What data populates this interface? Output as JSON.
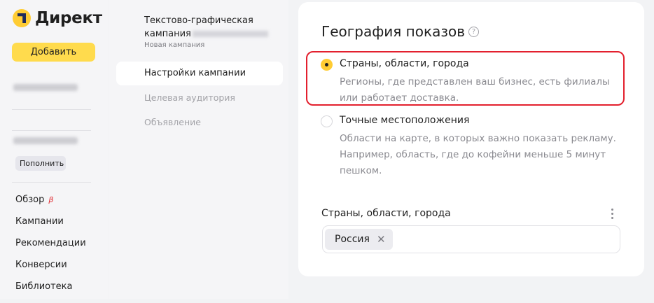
{
  "sidebar": {
    "logo_text": "Директ",
    "add_button": "Добавить",
    "topup_button": "Пополнить",
    "nav": [
      {
        "label": "Обзор",
        "badge": "β"
      },
      {
        "label": "Кампании"
      },
      {
        "label": "Рекомендации"
      },
      {
        "label": "Конверсии"
      },
      {
        "label": "Библиотека"
      }
    ]
  },
  "steps_panel": {
    "campaign_title_line1": "Текстово-графическая",
    "campaign_title_line2": "кампания",
    "campaign_subtitle": "Новая кампания",
    "steps": [
      {
        "label": "Настройки кампании",
        "active": true
      },
      {
        "label": "Целевая аудитория",
        "active": false
      },
      {
        "label": "Объявление",
        "active": false
      }
    ]
  },
  "main": {
    "title": "География показов",
    "help_icon": "?",
    "options": [
      {
        "label": "Страны, области, города",
        "description": "Регионы, где представлен ваш бизнес, есть филиалы или работает доставка.",
        "selected": true
      },
      {
        "label": "Точные местоположения",
        "description": "Области на карте, в которых важно показать рекламу. Например, область, где до кофейни меньше 5 минут пешком.",
        "selected": false
      }
    ],
    "field_label": "Страны, области, города",
    "chips": [
      {
        "label": "Россия",
        "remove_icon": "✕"
      }
    ]
  },
  "colors": {
    "accent_yellow": "#ffdb4d",
    "highlight_red": "#e3202e",
    "beta_red": "#e0282e"
  }
}
